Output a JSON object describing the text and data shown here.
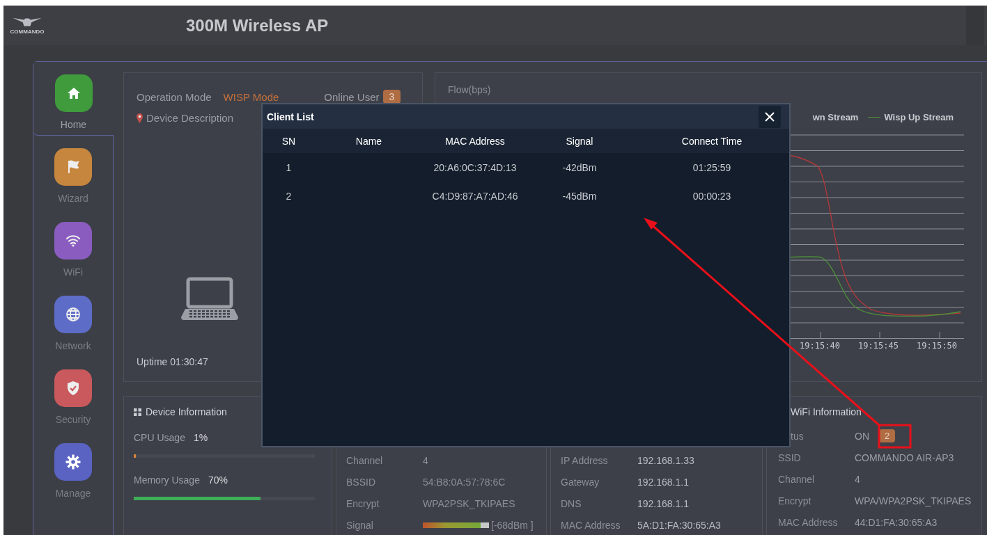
{
  "header": {
    "logo_text": "COMMANDO",
    "title": "300M Wireless AP"
  },
  "sidebar": {
    "items": [
      {
        "label": "Home",
        "kind": "home",
        "color": "#3f9b3c",
        "selected": true
      },
      {
        "label": "Wizard",
        "kind": "flag",
        "color": "#c7863d",
        "selected": false
      },
      {
        "label": "WiFi",
        "kind": "wifi",
        "color": "#8a5cc0",
        "selected": false
      },
      {
        "label": "Network",
        "kind": "globe",
        "color": "#5d6cc7",
        "selected": false
      },
      {
        "label": "Security",
        "kind": "shield",
        "color": "#c9595c",
        "selected": false
      },
      {
        "label": "Manage",
        "kind": "gear",
        "color": "#5a63c2",
        "selected": false
      }
    ]
  },
  "overview": {
    "operation_mode_label": "Operation Mode",
    "operation_mode": "WISP Mode",
    "online_user_label": "Online User",
    "online_user_count": "3",
    "description_label": "Device Description",
    "uptime": "Uptime 01:30:47"
  },
  "flow": {
    "title": "Flow(bps)",
    "legend": [
      {
        "label": "wn Stream"
      },
      {
        "label": "Wisp Up Stream",
        "color": "#4f8f3a"
      }
    ],
    "x_tick_labels": [
      "19:15:40",
      "19:15:45",
      "19:15:50"
    ]
  },
  "device_info": {
    "title": "Device Information",
    "meters": [
      {
        "label": "CPU Usage",
        "reading": "1%",
        "level": 0.01,
        "color": "#d8843a"
      },
      {
        "label": "Memory Usage",
        "reading": "70%",
        "level": 0.7,
        "color": "#3fae5a"
      }
    ]
  },
  "wisp_info": {
    "rows": [
      {
        "kind": "text",
        "label": "Channel",
        "value": "4"
      },
      {
        "kind": "text",
        "label": "BSSID",
        "value": "54:B8:0A:57:78:6C"
      },
      {
        "kind": "text",
        "label": "Encrypt",
        "value": "WPA2PSK_TKIPAES"
      },
      {
        "kind": "meter",
        "label": "Signal",
        "level": 0.87,
        "reading": "[-68dBm ]"
      }
    ]
  },
  "lan_info": {
    "rows": [
      {
        "label": "IP Address",
        "value": "192.168.1.33"
      },
      {
        "label": "Gateway",
        "value": "192.168.1.1"
      },
      {
        "label": "DNS",
        "value": "192.168.1.1"
      },
      {
        "label": "MAC Address",
        "value": "5A:D1:FA:30:65:A3"
      }
    ]
  },
  "wifi_info": {
    "title": "WiFi Information",
    "rows": [
      {
        "kind": "status",
        "label": "tus",
        "value": "ON",
        "badge": "2"
      },
      {
        "kind": "text",
        "label": "SSID",
        "value": "COMMANDO AIR-AP3"
      },
      {
        "kind": "text",
        "label": "Channel",
        "value": "4"
      },
      {
        "kind": "text",
        "label": "Encrypt",
        "value": "WPA/WPA2PSK_TKIPAES"
      },
      {
        "kind": "text",
        "label": "MAC Address",
        "value": "44:D1:FA:30:65:A3"
      }
    ]
  },
  "client_list": {
    "title": "Client List",
    "columns": [
      "SN",
      "Name",
      "MAC Address",
      "Signal",
      "Connect Time"
    ],
    "rows": [
      {
        "sn": "1",
        "mac": "20:A6:0C:37:4D:13",
        "signal": "-42dBm",
        "connect_time": "01:25:59"
      },
      {
        "sn": "2",
        "mac": "C4:D9:87:A7:AD:46",
        "signal": "-45dBm",
        "connect_time": "00:00:23"
      }
    ]
  }
}
